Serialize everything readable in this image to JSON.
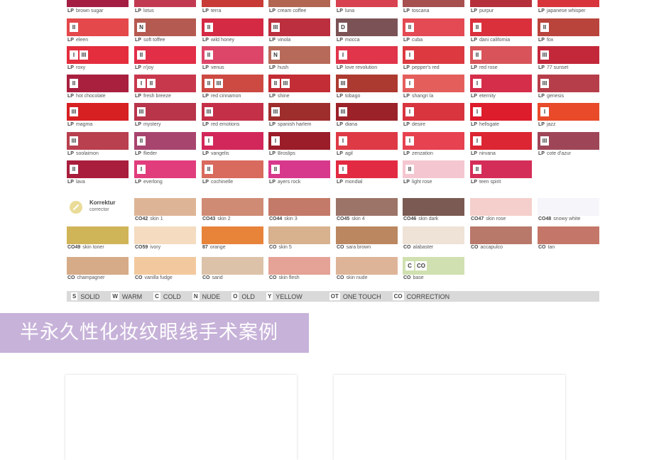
{
  "colors": {
    "legend_bg": "#d9d9d9",
    "banner_bg": "#c7b2d9",
    "banner_text": "#ffffff"
  },
  "chart_rows": [
    [
      {
        "prefix": "LP",
        "name": "brown sugar",
        "color": "#a41e44",
        "badges": []
      },
      {
        "prefix": "LP",
        "name": "lotus",
        "color": "#c23a52",
        "badges": []
      },
      {
        "prefix": "LP",
        "name": "terra",
        "color": "#c83a35",
        "badges": []
      },
      {
        "prefix": "LP",
        "name": "cream coffee",
        "color": "#b26652",
        "badges": []
      },
      {
        "prefix": "LP",
        "name": "luna",
        "color": "#d8414f",
        "badges": []
      },
      {
        "prefix": "LP",
        "name": "toscana",
        "color": "#a75050",
        "badges": []
      },
      {
        "prefix": "LP",
        "name": "purpur",
        "color": "#b5303a",
        "badges": []
      },
      {
        "prefix": "LP",
        "name": "japanese whisper",
        "color": "#d8343c",
        "badges": []
      }
    ],
    [
      {
        "prefix": "LP",
        "name": "eleen",
        "color": "#e4484a",
        "badges": [
          "II"
        ]
      },
      {
        "prefix": "LP",
        "name": "soft toffee",
        "color": "#b55a50",
        "badges": [
          "N"
        ]
      },
      {
        "prefix": "LP",
        "name": "wild honey",
        "color": "#d42a44",
        "badges": [
          "II"
        ]
      },
      {
        "prefix": "LP",
        "name": "vinola",
        "color": "#bb2f3e",
        "badges": [
          "III"
        ]
      },
      {
        "prefix": "LP",
        "name": "mocca",
        "color": "#7b5356",
        "badges": [
          "D"
        ]
      },
      {
        "prefix": "LP",
        "name": "cuba",
        "color": "#e34a53",
        "badges": [
          "II"
        ]
      },
      {
        "prefix": "LP",
        "name": "dani california",
        "color": "#d9303c",
        "badges": [
          "II"
        ]
      },
      {
        "prefix": "LP",
        "name": "fox",
        "color": "#b8443c",
        "badges": [
          "II"
        ]
      }
    ],
    [
      {
        "prefix": "LP",
        "name": "roxy",
        "color": "#e42d3d",
        "badges": [
          "I",
          "III"
        ]
      },
      {
        "prefix": "LP",
        "name": "n'joy",
        "color": "#e22e47",
        "badges": [
          "II"
        ]
      },
      {
        "prefix": "LP",
        "name": "venus",
        "color": "#dd4668",
        "badges": [
          "II"
        ]
      },
      {
        "prefix": "LP",
        "name": "hush",
        "color": "#b86a5a",
        "badges": [
          "N"
        ]
      },
      {
        "prefix": "LP",
        "name": "love revolution",
        "color": "#e0354a",
        "badges": [
          "I"
        ]
      },
      {
        "prefix": "LP",
        "name": "pepper's red",
        "color": "#dc3940",
        "badges": [
          "I"
        ]
      },
      {
        "prefix": "LP",
        "name": "red rose",
        "color": "#d8545a",
        "badges": [
          "II"
        ]
      },
      {
        "prefix": "LP",
        "name": "77 sunset",
        "color": "#c3283a",
        "badges": [
          "III"
        ]
      }
    ],
    [
      {
        "prefix": "LP",
        "name": "hot chocolate",
        "color": "#a9203f",
        "badges": [
          "II"
        ]
      },
      {
        "prefix": "LP",
        "name": "fresh breeze",
        "color": "#c8384d",
        "badges": [
          "I",
          "II"
        ]
      },
      {
        "prefix": "LP",
        "name": "red cinnamon",
        "color": "#cc4a42",
        "badges": [
          "II",
          "III"
        ]
      },
      {
        "prefix": "LP",
        "name": "shine",
        "color": "#c32d35",
        "badges": [
          "II",
          "III"
        ]
      },
      {
        "prefix": "LP",
        "name": "tobago",
        "color": "#ad3a30",
        "badges": [
          "III"
        ]
      },
      {
        "prefix": "LP",
        "name": "shangri la",
        "color": "#e45f5c",
        "badges": [
          "I"
        ]
      },
      {
        "prefix": "LP",
        "name": "eternity",
        "color": "#d52e4a",
        "badges": [
          "I"
        ]
      },
      {
        "prefix": "LP",
        "name": "genesis",
        "color": "#b63e4a",
        "badges": [
          "III"
        ]
      }
    ],
    [
      {
        "prefix": "LP",
        "name": "magma",
        "color": "#d72022",
        "badges": [
          "III"
        ]
      },
      {
        "prefix": "LP",
        "name": "mystery",
        "color": "#b8354a",
        "badges": [
          "III"
        ]
      },
      {
        "prefix": "LP",
        "name": "red emotions",
        "color": "#c43048",
        "badges": [
          "III"
        ]
      },
      {
        "prefix": "LP",
        "name": "spanish harlem",
        "color": "#9e2e2c",
        "badges": [
          "III"
        ]
      },
      {
        "prefix": "LP",
        "name": "diana",
        "color": "#9c2229",
        "badges": [
          "III"
        ]
      },
      {
        "prefix": "LP",
        "name": "desire",
        "color": "#d8353f",
        "badges": [
          "I"
        ]
      },
      {
        "prefix": "LP",
        "name": "hellsgate",
        "color": "#dd1c2c",
        "badges": [
          "I"
        ]
      },
      {
        "prefix": "LP",
        "name": "jazz",
        "color": "#e84a2a",
        "badges": [
          "I"
        ]
      }
    ],
    [
      {
        "prefix": "LP",
        "name": "soolaimon",
        "color": "#b8404f",
        "badges": [
          "III"
        ]
      },
      {
        "prefix": "LP",
        "name": "flieder",
        "color": "#a8456f",
        "badges": [
          "II"
        ]
      },
      {
        "prefix": "LP",
        "name": "vangelis",
        "color": "#d2275a",
        "badges": [
          "I"
        ]
      },
      {
        "prefix": "LP",
        "name": "Broslips",
        "color": "#9b1d2a",
        "badges": [
          "I"
        ]
      },
      {
        "prefix": "LP",
        "name": "agil",
        "color": "#de3a46",
        "badges": [
          "I"
        ]
      },
      {
        "prefix": "LP",
        "name": "zenzation",
        "color": "#e64250",
        "badges": [
          "I"
        ]
      },
      {
        "prefix": "LP",
        "name": "nirvana",
        "color": "#dc2633",
        "badges": [
          "I"
        ]
      },
      {
        "prefix": "LP",
        "name": "cote d'azur",
        "color": "#9e4658",
        "badges": [
          "III"
        ]
      }
    ],
    [
      {
        "prefix": "LP",
        "name": "lava",
        "color": "#a81e3c",
        "badges": [
          "II"
        ]
      },
      {
        "prefix": "LP",
        "name": "everlong",
        "color": "#e13d7d",
        "badges": [
          "I"
        ]
      },
      {
        "prefix": "LP",
        "name": "cochinelle",
        "color": "#d86a5e",
        "badges": [
          "II"
        ]
      },
      {
        "prefix": "LP",
        "name": "ayers rock",
        "color": "#d8388c",
        "badges": [
          "II"
        ]
      },
      {
        "prefix": "LP",
        "name": "mondial",
        "color": "#e22b42",
        "badges": [
          "I"
        ]
      },
      {
        "prefix": "LP",
        "name": "light rose",
        "color": "#f4c7d0",
        "badges": [
          "II"
        ]
      },
      {
        "prefix": "LP",
        "name": "teen spirit",
        "color": "#d42e58",
        "badges": [
          "II"
        ]
      }
    ]
  ],
  "corrector_title": "Korrektur",
  "corrector_subtitle": "corrector",
  "co_rows": [
    [
      null,
      {
        "prefix": "CO42",
        "name": "skin 1",
        "color": "#ddb596",
        "badges": []
      },
      {
        "prefix": "CO43",
        "name": "skin 2",
        "color": "#cf8b74",
        "badges": []
      },
      {
        "prefix": "CO44",
        "name": "skin 3",
        "color": "#c47a68",
        "badges": []
      },
      {
        "prefix": "CO45",
        "name": "skin 4",
        "color": "#9c7468",
        "badges": []
      },
      {
        "prefix": "CO46",
        "name": "skin dark",
        "color": "#7a5a52",
        "badges": []
      },
      {
        "prefix": "CO47",
        "name": "skin rose",
        "color": "#f4cfcb",
        "badges": []
      },
      {
        "prefix": "CO48",
        "name": "snowy white",
        "color": "#f5f5fa",
        "badges": []
      }
    ],
    [
      {
        "prefix": "CO49",
        "name": "skin toner",
        "color": "#d0b458",
        "badges": []
      },
      {
        "prefix": "CO59",
        "name": "ivory",
        "color": "#f5dcc0",
        "badges": []
      },
      {
        "prefix": "87",
        "name": "orange",
        "color": "#e8833a",
        "badges": []
      },
      {
        "prefix": "CO",
        "name": "skin 5",
        "color": "#d8b18e",
        "badges": []
      },
      {
        "prefix": "CO",
        "name": "sara brown",
        "color": "#bb8760",
        "badges": []
      },
      {
        "prefix": "CO",
        "name": "alabaster",
        "color": "#efe2d6",
        "badges": []
      },
      {
        "prefix": "CO",
        "name": "accapulco",
        "color": "#b8786a",
        "badges": []
      },
      {
        "prefix": "CO",
        "name": "tan",
        "color": "#c47768",
        "badges": []
      }
    ],
    [
      {
        "prefix": "CO",
        "name": "champagner",
        "color": "#d6ab88",
        "badges": []
      },
      {
        "prefix": "CO",
        "name": "vanilla fudge",
        "color": "#f2c99e",
        "badges": []
      },
      {
        "prefix": "CO",
        "name": "sand",
        "color": "#dcc2a8",
        "badges": []
      },
      {
        "prefix": "CO",
        "name": "skin flesh",
        "color": "#e4a396",
        "badges": []
      },
      {
        "prefix": "CO",
        "name": "skin nude",
        "color": "#deb498",
        "badges": []
      },
      {
        "prefix": "CO",
        "name": "base",
        "color": "#d0e0b0",
        "badges": [
          "C",
          "CO"
        ]
      }
    ]
  ],
  "legend": [
    {
      "code": "S",
      "label": "SOLID"
    },
    {
      "code": "W",
      "label": "WARM"
    },
    {
      "code": "C",
      "label": "COLD"
    },
    {
      "code": "N",
      "label": "NUDE"
    },
    {
      "code": "O",
      "label": "OLD"
    },
    {
      "code": "Y",
      "label": "YELLOW"
    },
    {
      "code": "OT",
      "label": "ONE TOUCH"
    },
    {
      "code": "CO",
      "label": "CORRECTION"
    }
  ],
  "banner_title": "半永久性化妆纹眼线手术案例"
}
